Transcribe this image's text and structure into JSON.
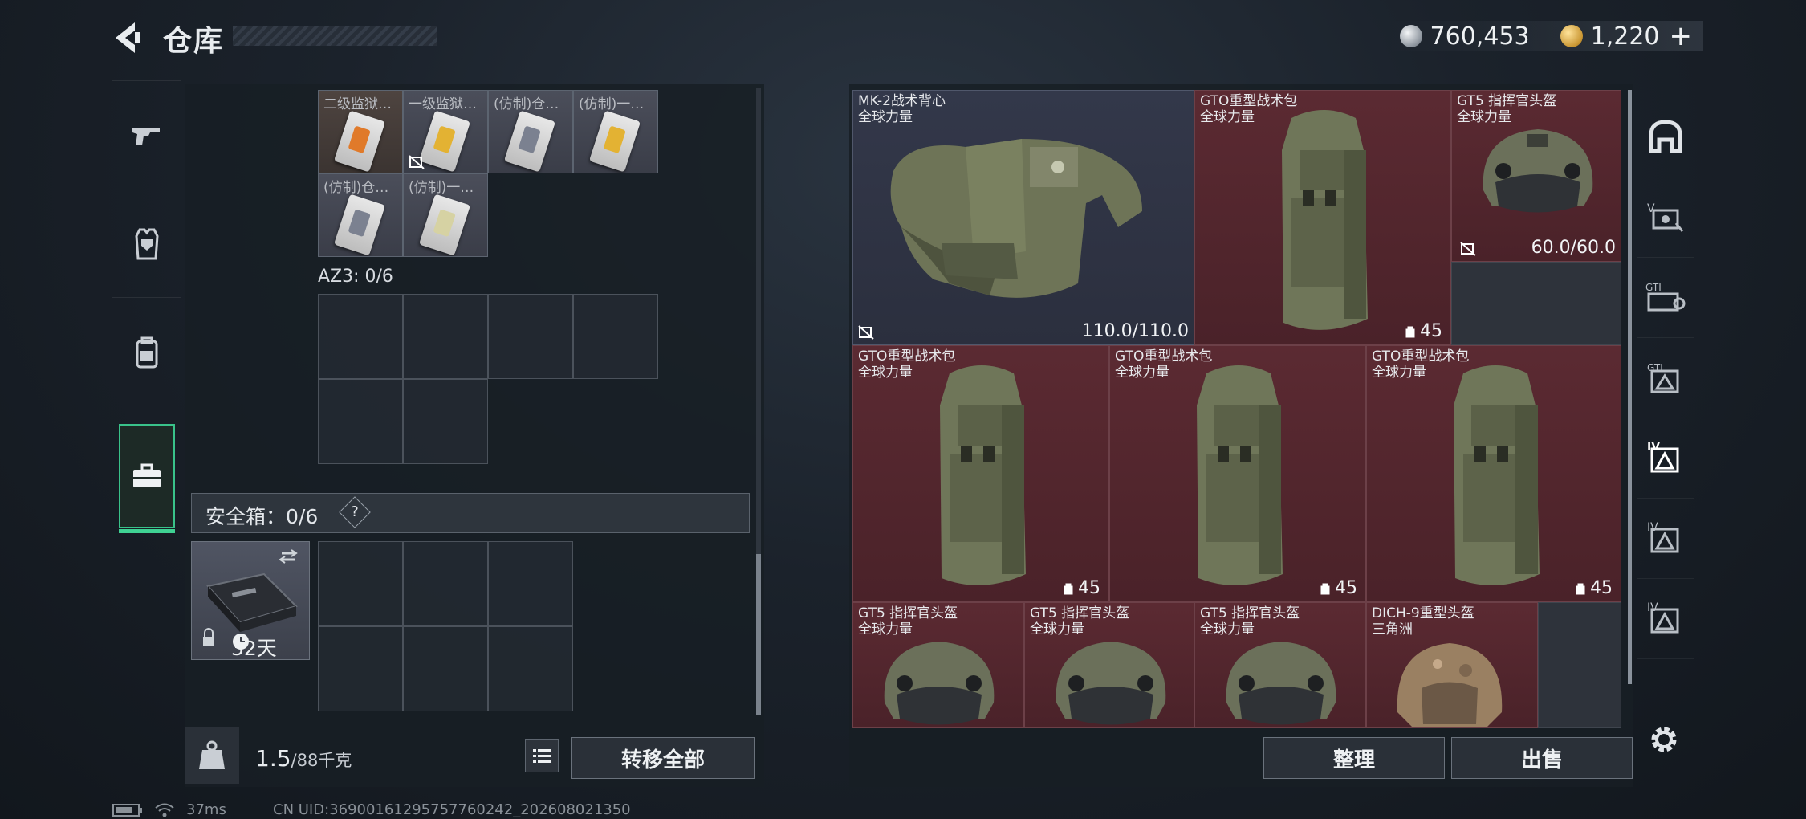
{
  "header": {
    "title": "仓库",
    "currency_primary": "760,453",
    "currency_secondary": "1,220",
    "currency_plus": "+",
    "icons": {
      "back": "back-arrow-icon",
      "silver_coin": "silver-coin-icon",
      "gold_coin": "gold-coin-icon"
    }
  },
  "left_tabs": [
    {
      "icon": "pistol-icon",
      "active": false
    },
    {
      "icon": "vest-icon",
      "active": false
    },
    {
      "icon": "backpack-icon",
      "active": false
    },
    {
      "icon": "briefcase-icon",
      "active": true
    }
  ],
  "left_panel": {
    "card_slots": [
      {
        "label": "二级监狱…",
        "color": "orange",
        "no_sell": false
      },
      {
        "label": "一级监狱…",
        "color": "yellow",
        "no_sell": true
      },
      {
        "label": "(仿制)仓…",
        "color": "gray",
        "no_sell": false
      },
      {
        "label": "(仿制)一…",
        "color": "yellow",
        "no_sell": false
      },
      {
        "label": "(仿制)仓…",
        "color": "gray",
        "no_sell": false
      },
      {
        "label": "(仿制)一…",
        "color": "pale",
        "no_sell": false
      }
    ],
    "az3_label": "AZ3: 0/6",
    "safe_box_label": "安全箱：0/6",
    "safe_box_help": "?",
    "safe_box_days": "32天",
    "weight_value": "1.5",
    "weight_unit": "/88千克",
    "transfer_all": "转移全部"
  },
  "right_panel": {
    "items": [
      {
        "name": "MK-2战术背心",
        "sub": "全球力量",
        "durability": "110.0/110.0",
        "capacity": "",
        "no_sell": true,
        "color": "blue"
      },
      {
        "name": "GTO重型战术包",
        "sub": "全球力量",
        "durability": "",
        "capacity": "45",
        "no_sell": false,
        "color": "red"
      },
      {
        "name": "GT5 指挥官头盔",
        "sub": "全球力量",
        "durability": "60.0/60.0",
        "capacity": "",
        "no_sell": true,
        "color": "red"
      },
      {
        "name": "GTO重型战术包",
        "sub": "全球力量",
        "durability": "",
        "capacity": "45",
        "no_sell": false,
        "color": "red"
      },
      {
        "name": "GTO重型战术包",
        "sub": "全球力量",
        "durability": "",
        "capacity": "45",
        "no_sell": false,
        "color": "red"
      },
      {
        "name": "GTO重型战术包",
        "sub": "全球力量",
        "durability": "",
        "capacity": "45",
        "no_sell": false,
        "color": "red"
      },
      {
        "name": "GT5 指挥官头盔",
        "sub": "全球力量",
        "durability": "",
        "capacity": "",
        "no_sell": false,
        "color": "red"
      },
      {
        "name": "GT5 指挥官头盔",
        "sub": "全球力量",
        "durability": "",
        "capacity": "",
        "no_sell": false,
        "color": "red"
      },
      {
        "name": "GT5 指挥官头盔",
        "sub": "全球力量",
        "durability": "",
        "capacity": "",
        "no_sell": false,
        "color": "red"
      },
      {
        "name": "DICH-9重型头盔",
        "sub": "三角洲",
        "durability": "",
        "capacity": "",
        "no_sell": false,
        "color": "red"
      }
    ],
    "sort": "整理",
    "sell": "出售"
  },
  "right_tabs": [
    {
      "icon": "helmet-slot-icon"
    },
    {
      "icon": "level-v-armor-icon"
    },
    {
      "icon": "gti-armor-icon"
    },
    {
      "icon": "gti-level-icon"
    },
    {
      "icon": "level-iv-helmet-icon"
    },
    {
      "icon": "level-iv-armor-icon"
    },
    {
      "icon": "level-iv-bag-icon"
    }
  ],
  "status": {
    "ping": "37ms",
    "uid": "CN UID:36900161295757760242_202608021350"
  },
  "colors": {
    "accent": "#3fd293",
    "item_red": "#5b2a32",
    "item_blue": "#33384a"
  }
}
